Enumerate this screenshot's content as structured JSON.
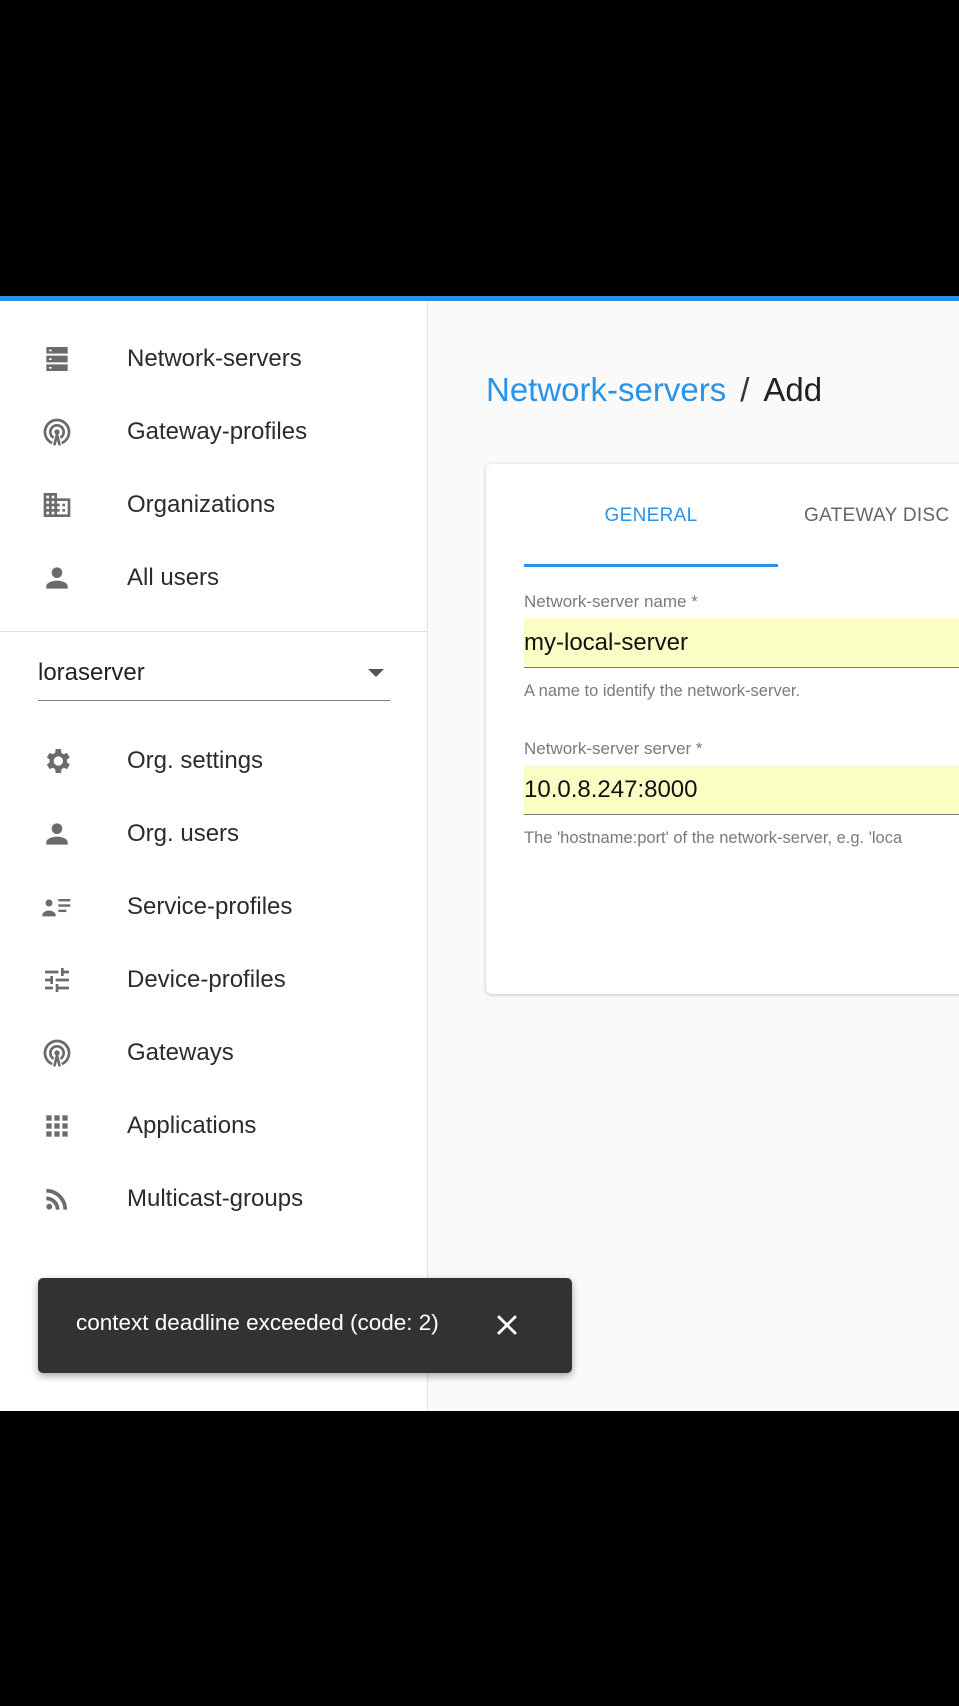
{
  "sidebar": {
    "admin_items": [
      {
        "label": "Network-servers",
        "icon": "dns-icon"
      },
      {
        "label": "Gateway-profiles",
        "icon": "radar-icon"
      },
      {
        "label": "Organizations",
        "icon": "domain-icon"
      },
      {
        "label": "All users",
        "icon": "person-icon"
      }
    ],
    "org_select": {
      "value": "loraserver"
    },
    "org_items": [
      {
        "label": "Org. settings",
        "icon": "gear-icon"
      },
      {
        "label": "Org. users",
        "icon": "person-icon"
      },
      {
        "label": "Service-profiles",
        "icon": "account-details-icon"
      },
      {
        "label": "Device-profiles",
        "icon": "tune-icon"
      },
      {
        "label": "Gateways",
        "icon": "radar-icon"
      },
      {
        "label": "Applications",
        "icon": "apps-grid-icon"
      },
      {
        "label": "Multicast-groups",
        "icon": "rss-icon"
      }
    ]
  },
  "breadcrumb": {
    "parent": "Network-servers",
    "separator": "/",
    "current": "Add"
  },
  "tabs": {
    "general": "GENERAL",
    "gateway_discovery": "GATEWAY DISC"
  },
  "form": {
    "name_label": "Network-server name *",
    "name_value": "my-local-server",
    "name_help": "A name to identify the network-server.",
    "server_label": "Network-server server *",
    "server_value": "10.0.8.247:8000",
    "server_help": "The 'hostname:port' of the network-server, e.g. 'loca"
  },
  "snackbar": {
    "message": "context deadline exceeded (code: 2)"
  },
  "colors": {
    "accent": "#2a93e8",
    "autofill": "#fafdc4",
    "snackbar": "#323232"
  }
}
